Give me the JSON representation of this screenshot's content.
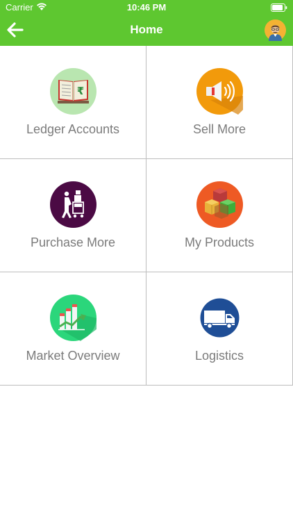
{
  "status_bar": {
    "carrier": "Carrier",
    "time": "10:46 PM"
  },
  "header": {
    "title": "Home",
    "back_icon": "arrow-left-icon",
    "avatar_icon": "user-avatar-icon"
  },
  "colors": {
    "header_bg": "#5ec730",
    "label": "#7b7b7b",
    "grid_line": "#bdbdbd"
  },
  "tiles": [
    {
      "label": "Ledger Accounts",
      "icon": "ledger-book-icon"
    },
    {
      "label": "Sell More",
      "icon": "megaphone-icon"
    },
    {
      "label": "Purchase More",
      "icon": "shopping-trolley-icon"
    },
    {
      "label": "My Products",
      "icon": "product-boxes-icon"
    },
    {
      "label": "Market Overview",
      "icon": "market-chart-icon"
    },
    {
      "label": "Logistics",
      "icon": "delivery-truck-icon"
    }
  ]
}
